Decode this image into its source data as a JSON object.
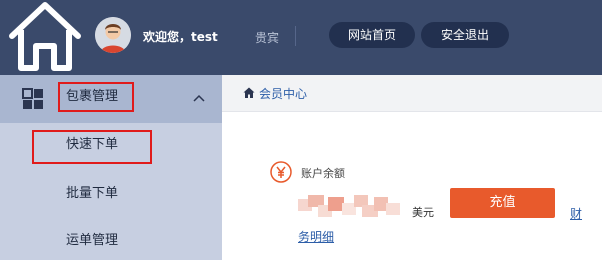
{
  "colors": {
    "header_bg": "#3a4a6b",
    "sidebar_bg": "#c7cfe1",
    "sidebar_header_bg": "#a9b6d0",
    "highlight_border": "#e01b1b",
    "accent_button": "#e85a2c",
    "link": "#2d5ea8"
  },
  "header": {
    "home_icon": "house-icon",
    "avatar_icon": "user-avatar",
    "welcome_text": "欢迎您，test",
    "role_text": "贵宾",
    "site_home_label": "网站首页",
    "logout_label": "安全退出"
  },
  "sidebar": {
    "menu_icon": "grid-icon",
    "menu_title": "包裹管理",
    "menu_expanded_icon": "chevron-up-icon",
    "items": [
      {
        "label": "快速下单"
      },
      {
        "label": "批量下单"
      },
      {
        "label": "运单管理"
      }
    ]
  },
  "main": {
    "breadcrumb_icon": "home-icon",
    "breadcrumb": "会员中心",
    "balance_icon": "yen-icon",
    "balance_label": "账户余额",
    "currency": "美元",
    "recharge_label": "充值",
    "side_link": "财",
    "detail_link": "务明细"
  }
}
